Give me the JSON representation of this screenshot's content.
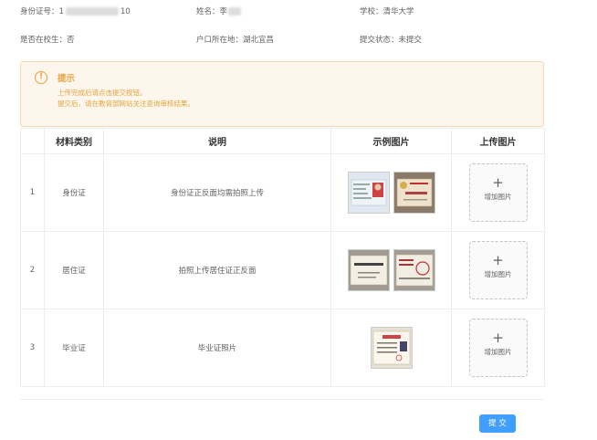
{
  "info": {
    "row1": {
      "id_label": "身份证号：",
      "id_prefix": "1",
      "id_suffix": "10",
      "name_label": "姓名：",
      "name_value": "李",
      "school_label": "学校：",
      "school_value": "清华大学"
    },
    "row2": {
      "enrolled_label": "是否在校生：",
      "enrolled_value": "否",
      "hukou_label": "户口所在地：",
      "hukou_value": "湖北宜昌",
      "status_label": "提交状态：",
      "status_value": "未提交"
    }
  },
  "alert": {
    "icon": "warning-circle-icon",
    "title": "提示",
    "line1": "上传完成后请点击提交按钮。",
    "line2": "提交后，请在教育部网站关注查询审核结果。"
  },
  "table": {
    "headers": [
      "",
      "材料类别",
      "说明",
      "示例图片",
      "上传图片"
    ],
    "rows": [
      {
        "index": "1",
        "category": "身份证",
        "description": "身份证正反面均需拍照上传",
        "upload_plus": "+",
        "upload_text": "增加图片"
      },
      {
        "index": "2",
        "category": "居住证",
        "description": "拍照上传居住证正反面",
        "upload_plus": "+",
        "upload_text": "增加图片"
      },
      {
        "index": "3",
        "category": "毕业证",
        "description": "毕业证照片",
        "upload_plus": "+",
        "upload_text": "增加图片"
      }
    ]
  },
  "submit_label": "提 交",
  "colors": {
    "primary": "#409eff",
    "warning": "#e6a23c",
    "warning_bg": "#fdf6ec",
    "border": "#ebeef5"
  }
}
